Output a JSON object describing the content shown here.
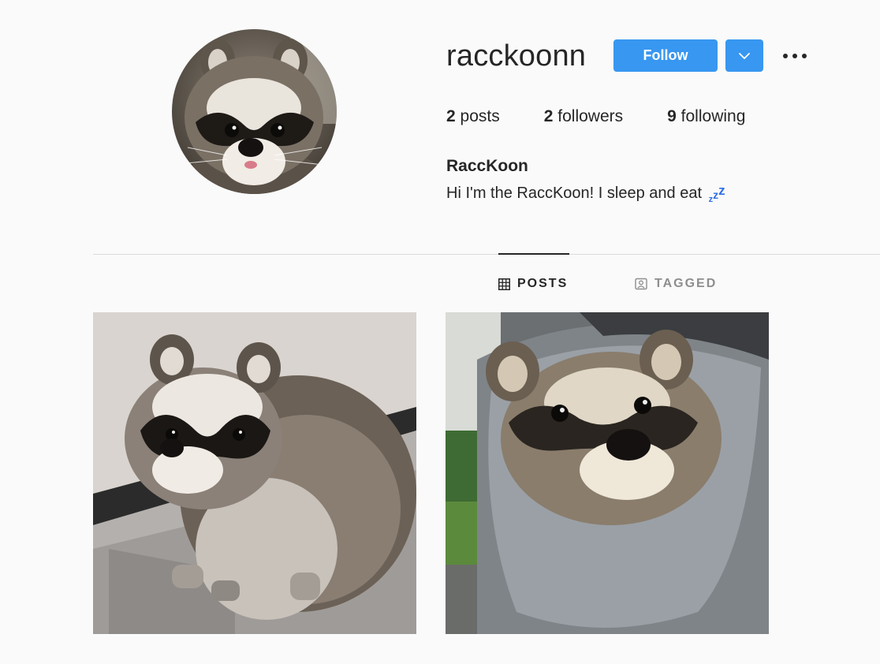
{
  "profile": {
    "username": "racckoonn",
    "full_name": "RaccKoon",
    "bio": "Hi I'm the RaccKoon! I sleep and eat",
    "bio_emoji": "zzz-emoji",
    "avatar_icon": "raccoon-avatar"
  },
  "actions": {
    "follow_label": "Follow",
    "dropdown_icon": "chevron-down-icon",
    "more_icon": "more-dots-icon"
  },
  "stats": {
    "posts_count": "2",
    "posts_label": "posts",
    "followers_count": "2",
    "followers_label": "followers",
    "following_count": "9",
    "following_label": "following"
  },
  "tabs": [
    {
      "label": "POSTS",
      "icon": "grid-icon",
      "active": true
    },
    {
      "label": "TAGGED",
      "icon": "tagged-icon",
      "active": false
    }
  ],
  "posts": [
    {
      "alt": "raccoon-photo"
    },
    {
      "alt": "raccoon-in-hood-photo"
    }
  ],
  "colors": {
    "accent": "#3897f0",
    "background": "#fafafa",
    "text": "#262626",
    "muted": "#8e8e8e",
    "divider": "#dbdbdb",
    "zzz": "#2f6fe4"
  }
}
